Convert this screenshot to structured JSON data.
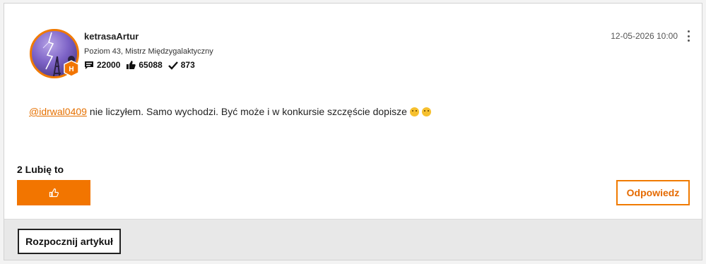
{
  "post": {
    "author": "ketrasaArtur",
    "rank": "Poziom 43, Mistrz Międzygalaktyczny",
    "rank_badge_letter": "H",
    "stats": {
      "messages": "22000",
      "kudos": "65088",
      "solutions": "873"
    },
    "timestamp": "12-05-2026 10:00",
    "mention": "@idrwal0409",
    "text": "nie liczyłem. Samo wychodzi. Być może i w konkursie szczęście dopisze",
    "emojis": [
      "thinking-emoji",
      "hugging-emoji"
    ]
  },
  "actions": {
    "likes_label": "2 Lubię to",
    "reply_label": "Odpowiedz"
  },
  "footer": {
    "start_article_label": "Rozpocznij artykuł"
  },
  "colors": {
    "accent": "#f27500",
    "mention": "#e57000"
  }
}
